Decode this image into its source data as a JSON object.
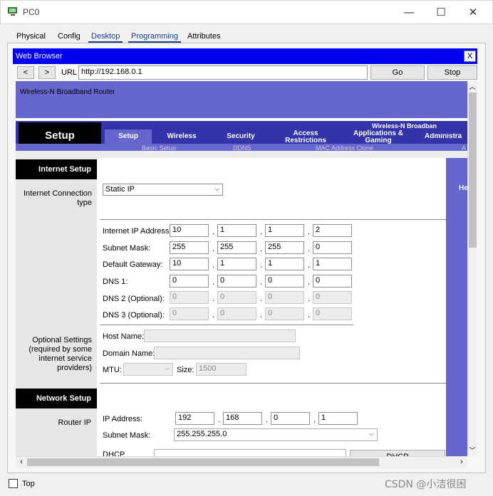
{
  "window": {
    "title": "PC0",
    "minimize_glyph": "—",
    "maximize_glyph": "☐",
    "close_glyph": "✕",
    "icon": "pc-icon"
  },
  "tabs": [
    "Physical",
    "Config",
    "Desktop",
    "Programming",
    "Attributes"
  ],
  "active_tab": "Desktop",
  "browser": {
    "title": "Web Browser",
    "close_label": "X",
    "back_label": "<",
    "forward_label": ">",
    "url_label": "URL",
    "url_value": "http://192.168.0.1",
    "go_label": "Go",
    "stop_label": "Stop"
  },
  "router": {
    "product_name": "Wireless-N Broadband Router",
    "model_banner": "Wireless-N Broadban",
    "setup_title": "Setup",
    "nav": [
      "Setup",
      "Wireless",
      "Security",
      "Access Restrictions",
      "Applications & Gaming",
      "Administra"
    ],
    "subnav": [
      "Basic Setup",
      "DDNS",
      "MAC Address Clone",
      "A"
    ],
    "help_partial": "He",
    "internet_setup": {
      "heading": "Internet Setup",
      "connection_label": "Internet Connection type",
      "connection_value": "Static IP",
      "ip_label": "Internet IP Address:",
      "ip": [
        "10",
        "1",
        "1",
        "2"
      ],
      "mask_label": "Subnet Mask:",
      "mask": [
        "255",
        "255",
        "255",
        "0"
      ],
      "gateway_label": "Default Gateway:",
      "gateway": [
        "10",
        "1",
        "1",
        "1"
      ],
      "dns1_label": "DNS 1:",
      "dns1": [
        "0",
        "0",
        "0",
        "0"
      ],
      "dns2_label": "DNS 2 (Optional):",
      "dns2": [
        "0",
        "0",
        "0",
        "0"
      ],
      "dns3_label": "DNS 3 (Optional):",
      "dns3": [
        "0",
        "0",
        "0",
        "0"
      ]
    },
    "optional_settings": {
      "label": "Optional Settings (required by some internet service providers)",
      "host_label": "Host Name:",
      "host_value": "",
      "domain_label": "Domain Name:",
      "domain_value": "",
      "mtu_label": "MTU:",
      "mtu_value": "",
      "size_label": "Size:",
      "size_value": "1500"
    },
    "network_setup": {
      "heading": "Network Setup",
      "router_ip_label": "Router IP",
      "ip_label": "IP Address:",
      "ip": [
        "192",
        "168",
        "0",
        "1"
      ],
      "mask_label": "Subnet Mask:",
      "mask_value": "255.255.255.0",
      "dhcp_label": "DHCP",
      "dhcp_button": "DHCP"
    }
  },
  "footer": {
    "top_label": "Top",
    "watermark": "CSDN @小洁很困"
  },
  "colors": {
    "router_purple": "#6666cc",
    "browser_bar": "#0000f0",
    "setup_black": "#000000",
    "nav_blue": "#3333aa"
  }
}
